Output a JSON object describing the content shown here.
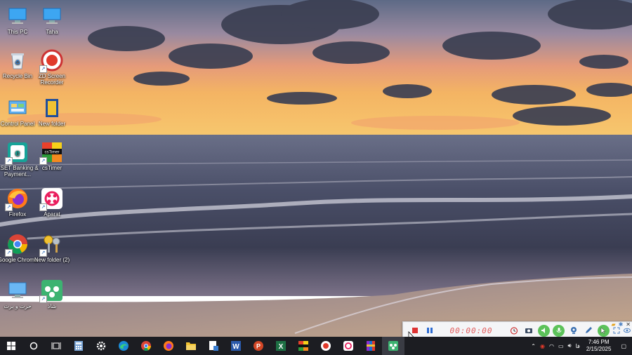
{
  "desktop": {
    "icons": [
      {
        "label": "This PC",
        "icon": "this-pc-icon"
      },
      {
        "label": "Taha",
        "icon": "user-pc-icon"
      },
      {
        "label": "Recycle Bin",
        "icon": "recycle-bin-icon"
      },
      {
        "label": "ZD Screen Recorder",
        "icon": "zd-recorder-icon"
      },
      {
        "label": "Control Panel",
        "icon": "control-panel-icon"
      },
      {
        "label": "New folder",
        "icon": "folder-icon"
      },
      {
        "label": "ESET Banking & Payment...",
        "icon": "eset-icon"
      },
      {
        "label": "csTimer",
        "icon": "cstimer-icon"
      },
      {
        "label": "Firefox",
        "icon": "firefox-icon"
      },
      {
        "label": "Aparat",
        "icon": "aparat-icon"
      },
      {
        "label": "Google Chrome",
        "icon": "chrome-icon"
      },
      {
        "label": "New folder (2)",
        "icon": "keys-folder-icon"
      },
      {
        "label": "حرث و برث",
        "icon": "monitor-icon"
      },
      {
        "label": "شاد",
        "icon": "shad-icon"
      }
    ]
  },
  "recorder": {
    "timer": "00:00:00"
  },
  "taskbar": {
    "apps": [
      "start",
      "cortana",
      "task-view",
      "calculator",
      "settings",
      "edge",
      "chrome",
      "firefox",
      "file-explorer",
      "snipping",
      "word",
      "powerpoint",
      "excel",
      "cstimer",
      "zd-recorder",
      "aparat",
      "winrar",
      "shad"
    ],
    "tray": {
      "language": "فا",
      "time": "7:46 PM",
      "date": "2/15/2025"
    }
  },
  "colors": {
    "taskbar_bg": "#1c1d22",
    "recorder_timer": "#e25b5b",
    "recorder_green": "#5cc25a"
  }
}
